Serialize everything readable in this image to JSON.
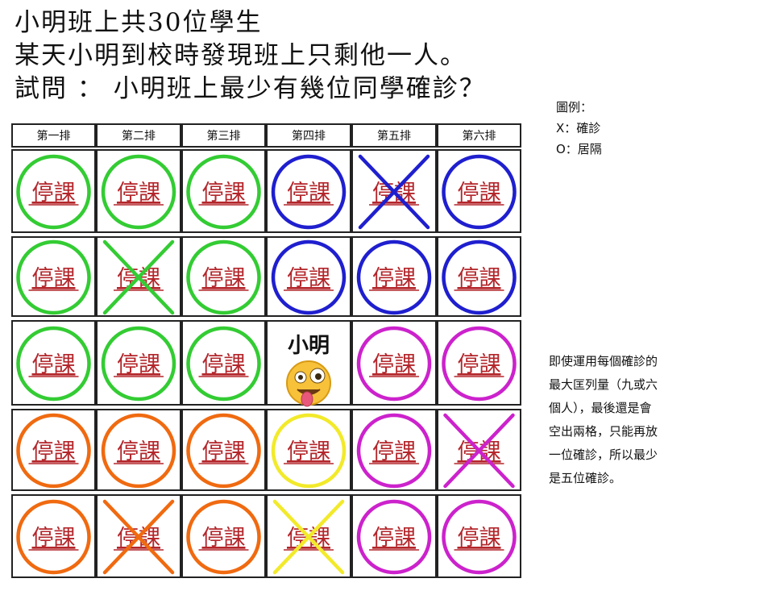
{
  "question": {
    "lines": [
      "小明班上共30位學生",
      "某天小明到校時發現班上只剩他一人。",
      "試問 ： 小明班上最少有幾位同學確診？"
    ]
  },
  "legend": {
    "title": "圖例：",
    "x_label": "X：確診",
    "o_label": "O：居隔"
  },
  "explanation": {
    "lines": [
      "即使運用每個確診的",
      "最大匡列量（九或六",
      "個人），最後還是會",
      "空出兩格，只能再放",
      "一位確診，所以最少",
      "是五位確診。"
    ]
  },
  "seating": {
    "columns": [
      "第一排",
      "第二排",
      "第三排",
      "第四排",
      "第五排",
      "第六排"
    ],
    "cell_text": "停課",
    "xiaoming_label": "小明",
    "colors": {
      "green": "#33cc33",
      "blue": "#1f1fcf",
      "magenta": "#cc22cc",
      "orange": "#f06a10",
      "yellow": "#f2ea2a",
      "cell_text": "#b3262b"
    },
    "grid": [
      [
        {
          "mark": "circle",
          "color": "green"
        },
        {
          "mark": "circle",
          "color": "green"
        },
        {
          "mark": "circle",
          "color": "green"
        },
        {
          "mark": "circle",
          "color": "blue"
        },
        {
          "mark": "x",
          "color": "blue"
        },
        {
          "mark": "circle",
          "color": "blue"
        }
      ],
      [
        {
          "mark": "circle",
          "color": "green"
        },
        {
          "mark": "x",
          "color": "green"
        },
        {
          "mark": "circle",
          "color": "green"
        },
        {
          "mark": "circle",
          "color": "blue"
        },
        {
          "mark": "circle",
          "color": "blue"
        },
        {
          "mark": "circle",
          "color": "blue"
        }
      ],
      [
        {
          "mark": "circle",
          "color": "green"
        },
        {
          "mark": "circle",
          "color": "green"
        },
        {
          "mark": "circle",
          "color": "green"
        },
        {
          "mark": "xiaoming",
          "color": ""
        },
        {
          "mark": "circle",
          "color": "magenta"
        },
        {
          "mark": "circle",
          "color": "magenta"
        }
      ],
      [
        {
          "mark": "circle",
          "color": "orange"
        },
        {
          "mark": "circle",
          "color": "orange"
        },
        {
          "mark": "circle",
          "color": "orange"
        },
        {
          "mark": "circle",
          "color": "yellow"
        },
        {
          "mark": "circle",
          "color": "magenta"
        },
        {
          "mark": "x",
          "color": "magenta"
        }
      ],
      [
        {
          "mark": "circle",
          "color": "orange"
        },
        {
          "mark": "x",
          "color": "orange"
        },
        {
          "mark": "circle",
          "color": "orange"
        },
        {
          "mark": "x",
          "color": "yellow"
        },
        {
          "mark": "circle",
          "color": "magenta"
        },
        {
          "mark": "circle",
          "color": "magenta"
        }
      ]
    ]
  }
}
